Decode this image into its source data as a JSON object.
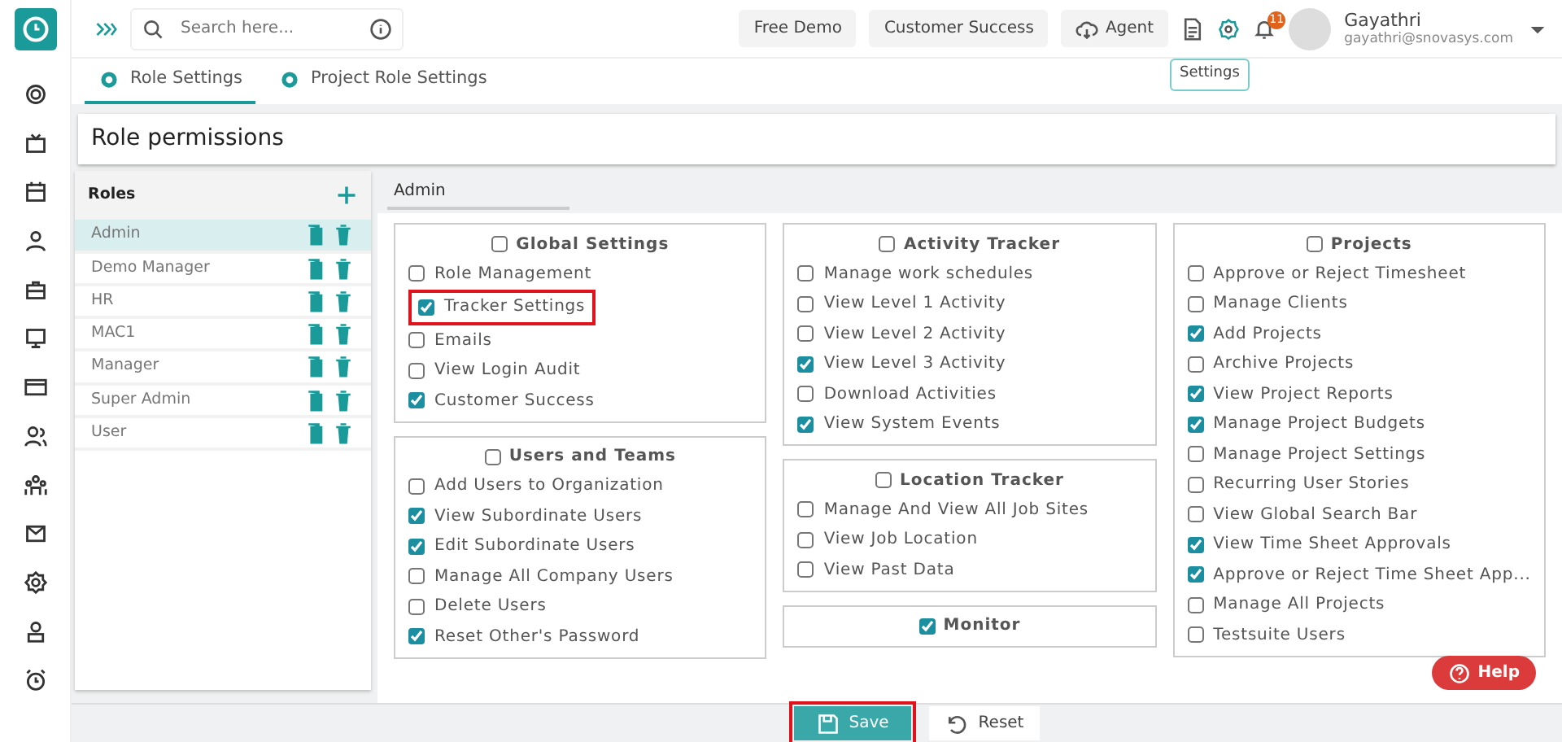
{
  "topbar": {
    "search": {
      "placeholder": "Search here..."
    },
    "buttons": [
      {
        "label": "Free Demo",
        "kind": "plain"
      },
      {
        "label": "Customer Success",
        "kind": "plain"
      },
      {
        "label": "Agent",
        "kind": "cloud"
      }
    ],
    "notification_count": "11",
    "tooltip": "Settings",
    "user": {
      "name": "Gayathri",
      "email": "gayathri@snovasys.com"
    }
  },
  "tabs": [
    {
      "label": "Role Settings",
      "selected": true
    },
    {
      "label": "Project Role Settings",
      "selected": false
    }
  ],
  "page_title": "Role permissions",
  "roles": {
    "title": "Roles",
    "items": [
      {
        "label": "Admin",
        "selected": true
      },
      {
        "label": "Demo Manager",
        "selected": false
      },
      {
        "label": "HR",
        "selected": false
      },
      {
        "label": "MAC1",
        "selected": false
      },
      {
        "label": "Manager",
        "selected": false
      },
      {
        "label": "Super Admin",
        "selected": false
      },
      {
        "label": "User",
        "selected": false
      }
    ]
  },
  "role_name": "Admin",
  "columns": [
    [
      {
        "title": "Global Settings",
        "checked": false,
        "items": [
          {
            "label": "Role Management",
            "checked": false
          },
          {
            "label": "Tracker Settings",
            "checked": true,
            "highlighted": true
          },
          {
            "label": "Emails",
            "checked": false
          },
          {
            "label": "View Login Audit",
            "checked": false
          },
          {
            "label": "Customer Success",
            "checked": true
          }
        ]
      },
      {
        "title": "Users and Teams",
        "checked": false,
        "items": [
          {
            "label": "Add Users to Organization",
            "checked": false
          },
          {
            "label": "View Subordinate Users",
            "checked": true
          },
          {
            "label": "Edit Subordinate Users",
            "checked": true
          },
          {
            "label": "Manage All Company Users",
            "checked": false
          },
          {
            "label": "Delete Users",
            "checked": false
          },
          {
            "label": "Reset Other's Password",
            "checked": true
          }
        ]
      }
    ],
    [
      {
        "title": "Activity Tracker",
        "checked": false,
        "items": [
          {
            "label": "Manage work schedules",
            "checked": false
          },
          {
            "label": "View Level 1 Activity",
            "checked": false
          },
          {
            "label": "View Level 2 Activity",
            "checked": false
          },
          {
            "label": "View Level 3 Activity",
            "checked": true
          },
          {
            "label": "Download Activities",
            "checked": false
          },
          {
            "label": "View System Events",
            "checked": true
          }
        ]
      },
      {
        "title": "Location Tracker",
        "checked": false,
        "items": [
          {
            "label": "Manage And View All Job Sites",
            "checked": false
          },
          {
            "label": "View Job Location",
            "checked": false
          },
          {
            "label": "View Past Data",
            "checked": false
          }
        ]
      },
      {
        "title": "Monitor",
        "checked": true
      }
    ],
    [
      {
        "title": "Projects",
        "checked": false,
        "items": [
          {
            "label": "Approve or Reject Timesheet",
            "checked": false
          },
          {
            "label": "Manage Clients",
            "checked": false
          },
          {
            "label": "Add Projects",
            "checked": true
          },
          {
            "label": "Archive Projects",
            "checked": false
          },
          {
            "label": "View Project Reports",
            "checked": true
          },
          {
            "label": "Manage Project Budgets",
            "checked": true
          },
          {
            "label": "Manage Project Settings",
            "checked": false
          },
          {
            "label": "Recurring User Stories",
            "checked": false
          },
          {
            "label": "View Global Search Bar",
            "checked": false
          },
          {
            "label": "View Time Sheet Approvals",
            "checked": true
          },
          {
            "label": "Approve or Reject Time Sheet App...",
            "checked": true
          },
          {
            "label": "Manage All Projects",
            "checked": false
          },
          {
            "label": "Testsuite Users",
            "checked": false
          }
        ]
      }
    ]
  ],
  "footer": {
    "save": {
      "label": "Save",
      "highlighted": true
    },
    "reset": {
      "label": "Reset"
    },
    "help": "Help"
  }
}
